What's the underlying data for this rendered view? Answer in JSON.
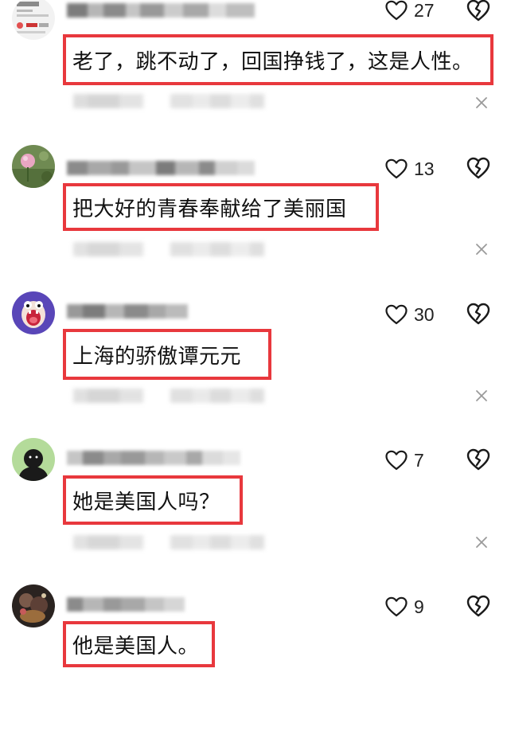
{
  "comments": [
    {
      "text": "老了，跳不动了，回国挣钱了，这是人性。",
      "likes": "27",
      "avatar": "card-thumbnail-avatar"
    },
    {
      "text": "把大好的青春奉献给了美丽国",
      "likes": "13",
      "avatar": "flower-field-avatar"
    },
    {
      "text": "上海的骄傲谭元元",
      "likes": "30",
      "avatar": "purple-monster-avatar"
    },
    {
      "text": "她是美国人吗？",
      "likes": "7",
      "avatar": "black-figure-green-avatar"
    },
    {
      "text": "他是美国人。",
      "likes": "9",
      "avatar": "dark-photo-avatar"
    }
  ],
  "icons": {
    "like": "heart-outline-icon",
    "dislike": "broken-heart-icon",
    "close": "close-x-icon"
  },
  "colors": {
    "highlight_border": "#e8383d",
    "icon_stroke": "#1a1a1a",
    "close_icon": "#9a9a9a"
  }
}
